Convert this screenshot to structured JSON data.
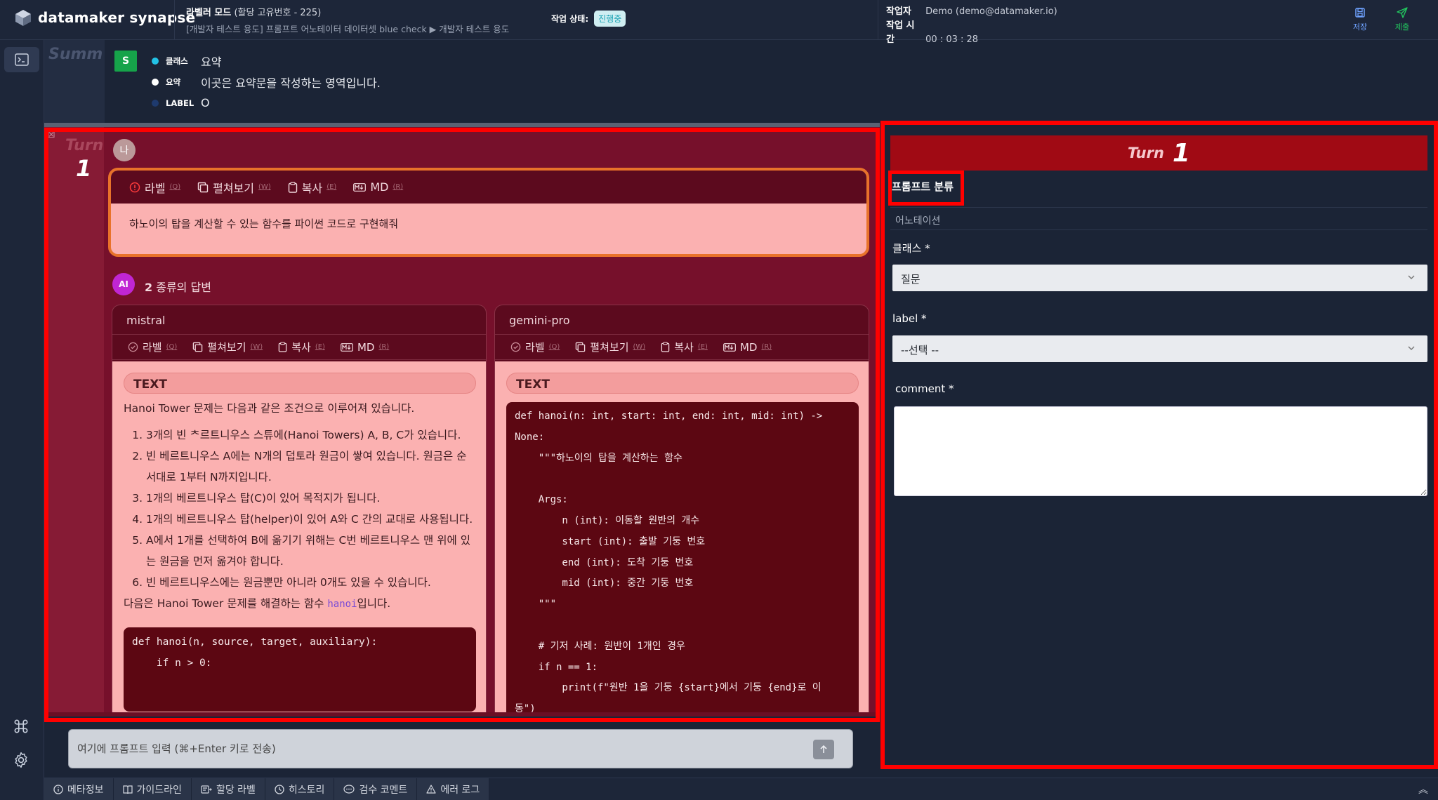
{
  "app": {
    "name": "datamaker synapse"
  },
  "header": {
    "mode_title": "라벨러 모드",
    "mode_id": "(할당 고유번호 - 225)",
    "breadcrumb": "[개발자 테스트 용도] 프롬프트 어노테이터 데이터셋 blue check ▶ 개발자 테스트 용도",
    "status_label": "작업 상태:",
    "status_value": "진행중",
    "worker_label": "작업자",
    "worker_value": "Demo (demo@datamaker.io)",
    "time_label": "작업 시간",
    "time_value": "00 : 03 : 28",
    "save_label": "저장",
    "submit_label": "제출"
  },
  "summary": {
    "side_label": "Summ",
    "badge": "S",
    "rows": [
      {
        "key": "클래스",
        "value": "요약",
        "color": "#22c2e6"
      },
      {
        "key": "요약",
        "value": "이곳은 요약문을 작성하는 영역입니다.",
        "color": "#ffffff"
      },
      {
        "key": "LABEL",
        "value": "O",
        "color": "#1e3a6e"
      }
    ]
  },
  "turn": {
    "label": "Turn",
    "number": "1",
    "user_avatar": "나",
    "prompt_toolbar": [
      {
        "label": "라벨",
        "hotkey": "(Q)"
      },
      {
        "label": "펼쳐보기",
        "hotkey": "(W)"
      },
      {
        "label": "복사",
        "hotkey": "(E)"
      },
      {
        "label": "MD",
        "hotkey": "(R)"
      }
    ],
    "prompt_text": "하노이의 탑을 계산할 수 있는 함수를 파이썬 코드로 구현해줘",
    "ai_avatar": "AI",
    "ai_count": "2",
    "ai_title_suffix": "종류의 답변",
    "responses": [
      {
        "model": "mistral",
        "toolbar": [
          {
            "label": "라벨",
            "hotkey": "(Q)"
          },
          {
            "label": "펼쳐보기",
            "hotkey": "(W)"
          },
          {
            "label": "복사",
            "hotkey": "(E)"
          },
          {
            "label": "MD",
            "hotkey": "(R)"
          }
        ],
        "type_label": "TEXT",
        "intro": "Hanoi Tower 문제는 다음과 같은 조건으로 이루어져 있습니다.",
        "items": [
          "3개의 빈 ᄎ르트니우스 스튜에(Hanoi Towers) A, B, C가 있습니다.",
          "빈 베르트니우스 A에는 N개의 덥토라 원금이 쌓여 있습니다. 원금은 순서대로 1부터 N까지입니다.",
          "1개의 베르트니우스 탑(C)이 있어 목적지가 됩니다.",
          "1개의 베르트니우스 탑(helper)이 있어 A와 C 간의 교대로 사용됩니다.",
          "A에서 1개를 선택하여 B에 옮기기 위해는 C번 베르트니우스 맨 위에 있는 원금을 먼저 옮겨야 합니다.",
          "빈 베르트니우스에는 원금뿐만 아니라 0개도 있을 수 있습니다."
        ],
        "outro_prefix": "다음은 Hanoi Tower 문제를 해결하는 함수 ",
        "outro_code": "hanoi",
        "outro_suffix": "입니다.",
        "code": "def hanoi(n, source, target, auxiliary):\n    if n > 0:"
      },
      {
        "model": "gemini-pro",
        "toolbar": [
          {
            "label": "라벨",
            "hotkey": "(Q)"
          },
          {
            "label": "펼쳐보기",
            "hotkey": "(W)"
          },
          {
            "label": "복사",
            "hotkey": "(E)"
          },
          {
            "label": "MD",
            "hotkey": "(R)"
          }
        ],
        "type_label": "TEXT",
        "code": "def hanoi(n: int, start: int, end: int, mid: int) ->\nNone:\n    \"\"\"하노이의 탑을 계산하는 함수\n\n    Args:\n        n (int): 이동할 원반의 개수\n        start (int): 출발 기둥 번호\n        end (int): 도착 기둥 번호\n        mid (int): 중간 기둥 번호\n    \"\"\"\n\n    # 기저 사례: 원반이 1개인 경우\n    if n == 1:\n        print(f\"원반 1을 기둥 {start}에서 기둥 {end}로 이\n동\")"
      }
    ]
  },
  "prompt_input": {
    "placeholder": "여기에 프롬프트 입력 (⌘+Enter 키로 전송)"
  },
  "bottom_tabs": [
    "메타정보",
    "가이드라인",
    "할당 라벨",
    "히스토리",
    "검수 코멘트",
    "에러 로그"
  ],
  "right_panel": {
    "turn_label": "Turn",
    "turn_number": "1",
    "section_title": "프롬프트 분류",
    "tab_label": "어노테이션",
    "class_label": "클래스 *",
    "class_value": "질문",
    "label_label": "label *",
    "label_value": "--선택 --",
    "comment_label": "comment *"
  },
  "colors": {
    "highlight": "#ff0000",
    "turn_bg": "#76102b",
    "header_bg": "#1d2639"
  }
}
